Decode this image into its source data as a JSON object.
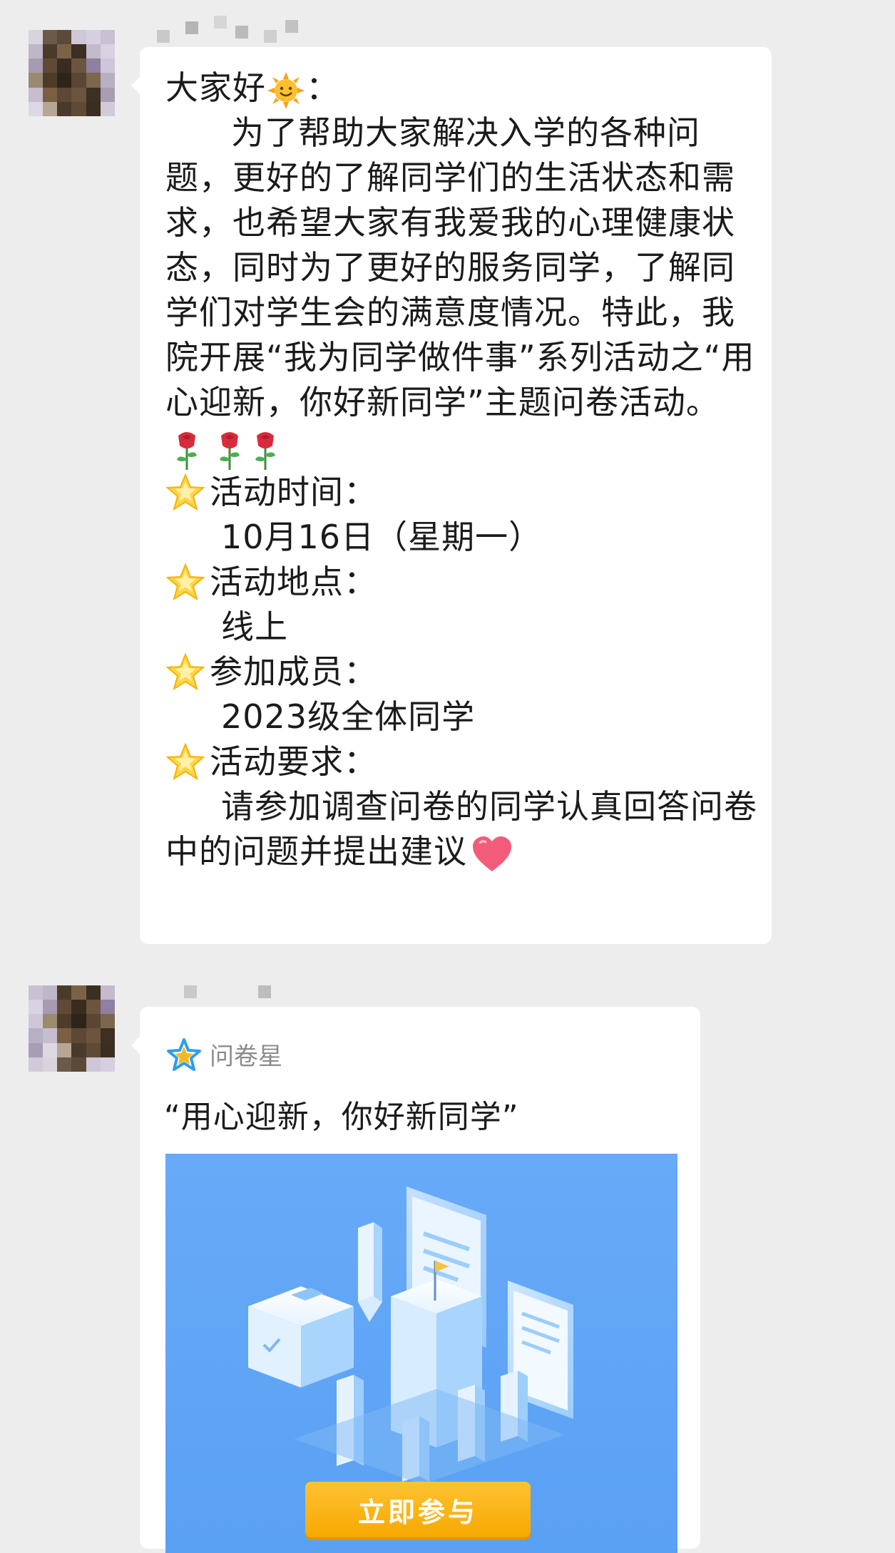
{
  "messages": [
    {
      "greeting": "大家好",
      "greeting_suffix": "：",
      "intro_part1": "为了帮助大家解决入学的各种问题，更好的了解同学们的生活状态和需求，也希望大家有我爱我的心理健康状态，同时为了更好的服务同学，了解同学们对学生会的满意度情况。特此，我院开展“我为同学做件事”系列活动之“用心迎新，你好新同学”主题问卷活动。",
      "items": [
        {
          "label": "活动时间：",
          "value": "10月16日（星期一）"
        },
        {
          "label": "活动地点：",
          "value": "线上"
        },
        {
          "label": "参加成员：",
          "value": "2023级全体同学"
        },
        {
          "label": "活动要求：",
          "value": "请参加调查问卷的同学认真回答问卷中的问题并提出建议"
        }
      ]
    }
  ],
  "card": {
    "source": "问卷星",
    "title": "“用心迎新，你好新同学”",
    "button_label": "立即参与"
  },
  "colors": {
    "background": "#ededed",
    "bubble": "#ffffff",
    "card_image": "#5aa0f3",
    "button": "#f7a800"
  },
  "icons": [
    "sun-emoji",
    "rose-emoji",
    "star-emoji",
    "heart-emoji",
    "wenjuanxing-star-icon"
  ]
}
